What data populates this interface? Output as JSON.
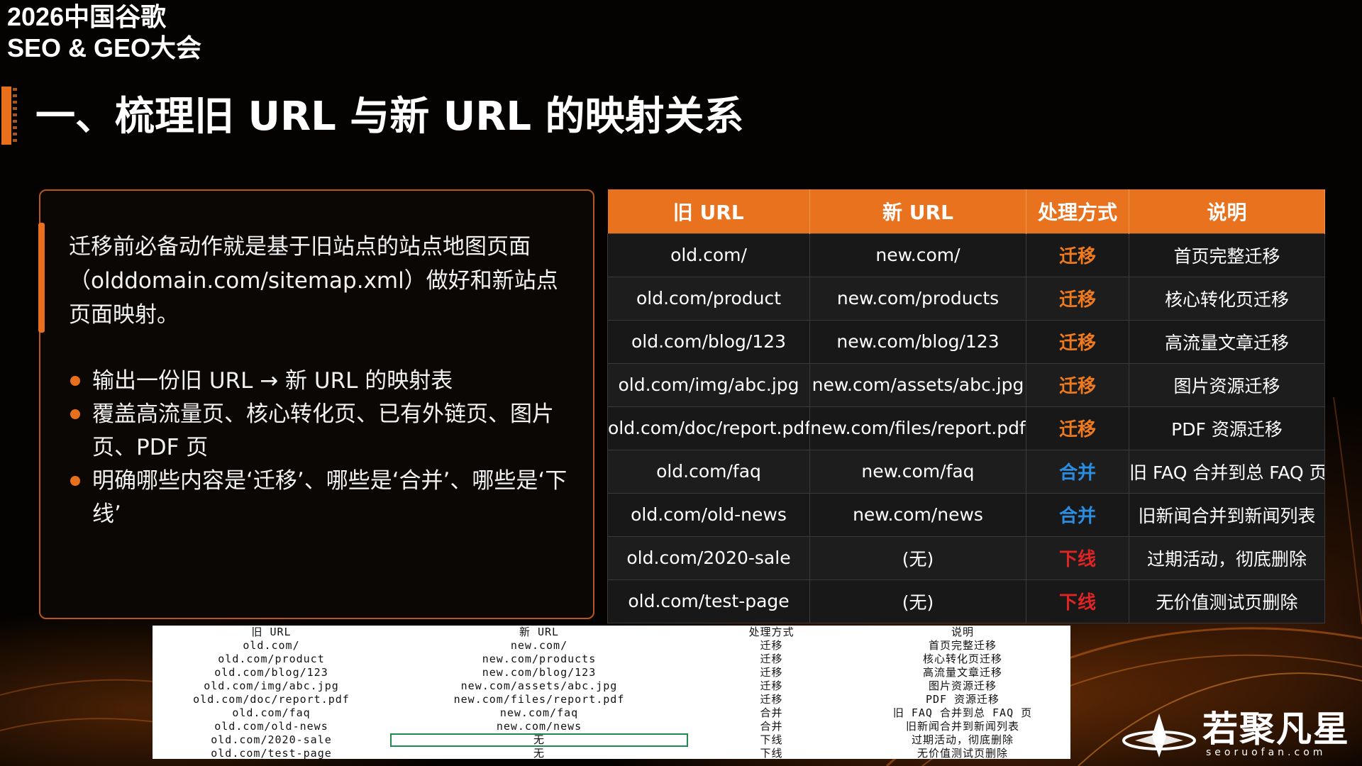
{
  "conference": {
    "line1": "2026中国谷歌",
    "line2": "SEO & GEO大会"
  },
  "page_title": "一、梳理旧 URL 与新 URL 的映射关系",
  "left_card": {
    "intro": "迁移前必备动作就是基于旧站点的站点地图页面（olddomain.com/sitemap.xml）做好和新站点页面映射。",
    "bullets": [
      "输出一份旧 URL → 新 URL 的映射表",
      "覆盖高流量页、核心转化页、已有外链页、图片页、PDF 页",
      "明确哪些内容是‘迁移’、哪些是‘合并’、哪些是‘下线’"
    ]
  },
  "mapping_table": {
    "headers": [
      "旧 URL",
      "新 URL",
      "处理方式",
      "说明"
    ],
    "rows": [
      [
        "old.com/",
        "new.com/",
        "迁移",
        "首页完整迁移"
      ],
      [
        "old.com/product",
        "new.com/products",
        "迁移",
        "核心转化页迁移"
      ],
      [
        "old.com/blog/123",
        "new.com/blog/123",
        "迁移",
        "高流量文章迁移"
      ],
      [
        "old.com/img/abc.jpg",
        "new.com/assets/abc.jpg",
        "迁移",
        "图片资源迁移"
      ],
      [
        "old.com/doc/report.pdf",
        "new.com/files/report.pdf",
        "迁移",
        "PDF 资源迁移"
      ],
      [
        "old.com/faq",
        "new.com/faq",
        "合并",
        "旧 FAQ 合并到总 FAQ 页"
      ],
      [
        "old.com/old-news",
        "new.com/news",
        "合并",
        "旧新闻合并到新闻列表"
      ],
      [
        "old.com/2020-sale",
        "(无)",
        "下线",
        "过期活动，彻底删除"
      ],
      [
        "old.com/test-page",
        "(无)",
        "下线",
        "无价值测试页删除"
      ]
    ],
    "method_colors": {
      "迁移": "#f07a1e",
      "合并": "#2a8de0",
      "下线": "#e02424"
    }
  },
  "sheet_overlay": {
    "headers": [
      "旧 URL",
      "新 URL",
      "处理方式",
      "说明"
    ],
    "rows": [
      [
        "old.com/",
        "new.com/",
        "迁移",
        "首页完整迁移"
      ],
      [
        "old.com/product",
        "new.com/products",
        "迁移",
        "核心转化页迁移"
      ],
      [
        "old.com/blog/123",
        "new.com/blog/123",
        "迁移",
        "高流量文章迁移"
      ],
      [
        "old.com/img/abc.jpg",
        "new.com/assets/abc.jpg",
        "迁移",
        "图片资源迁移"
      ],
      [
        "old.com/doc/report.pdf",
        "new.com/files/report.pdf",
        "迁移",
        "PDF 资源迁移"
      ],
      [
        "old.com/faq",
        "new.com/faq",
        "合并",
        "旧 FAQ 合并到总 FAQ 页"
      ],
      [
        "old.com/old-news",
        "new.com/news",
        "合并",
        "旧新闻合并到新闻列表"
      ],
      [
        "old.com/2020-sale",
        "无",
        "下线",
        "过期活动，彻底删除"
      ],
      [
        "old.com/test-page",
        "无",
        "下线",
        "无价值测试页删除"
      ]
    ],
    "selected_cell": {
      "row": 7,
      "col": 1
    }
  },
  "logo": {
    "name": "若聚凡星",
    "domain": "seoruofan.com",
    "icon": "star-logo-icon"
  },
  "colors": {
    "accent": "#e8701c",
    "background": "#050301"
  }
}
